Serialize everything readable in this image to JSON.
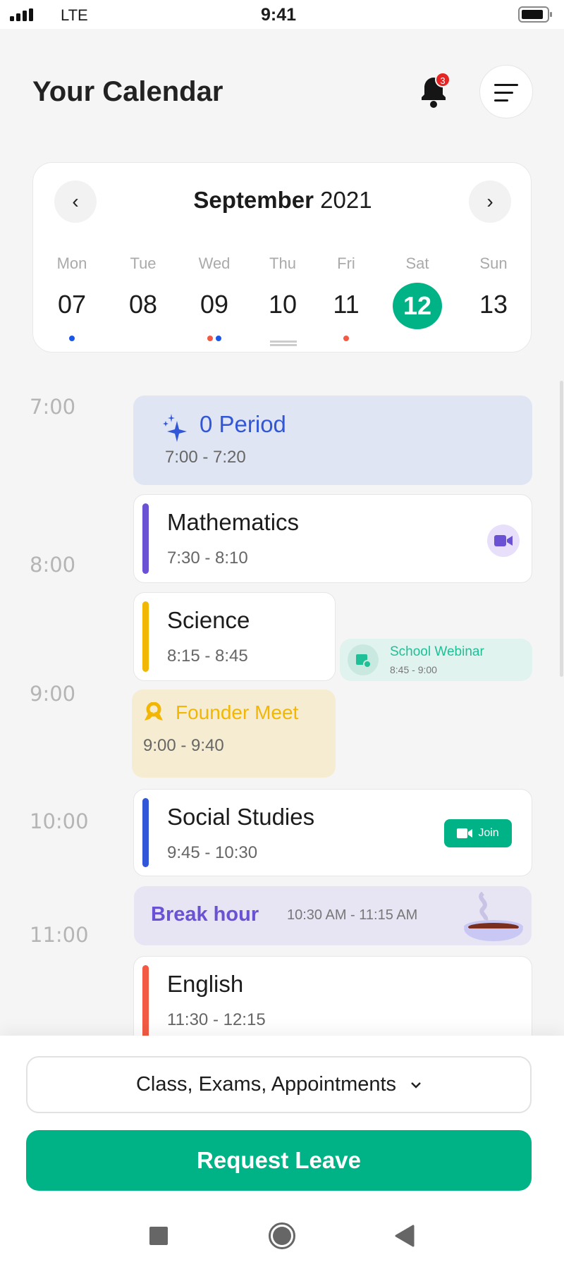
{
  "status_bar": {
    "carrier": "LTE",
    "time": "9:41"
  },
  "header": {
    "title": "Your Calendar",
    "notification_count": "3"
  },
  "calendar": {
    "month": "September",
    "year": "2021",
    "days": [
      {
        "weekday": "Mon",
        "date": "07",
        "dots": [
          "#1a56e8"
        ]
      },
      {
        "weekday": "Tue",
        "date": "08",
        "dots": []
      },
      {
        "weekday": "Wed",
        "date": "09",
        "dots": [
          "#f25a43",
          "#1a56e8"
        ]
      },
      {
        "weekday": "Thu",
        "date": "10",
        "dots": []
      },
      {
        "weekday": "Fri",
        "date": "11",
        "dots": [
          "#f25a43"
        ]
      },
      {
        "weekday": "Sat",
        "date": "12",
        "dots": [],
        "selected": true
      },
      {
        "weekday": "Sun",
        "date": "13",
        "dots": []
      }
    ]
  },
  "timeline": {
    "hours": [
      "7:00",
      "8:00",
      "9:00",
      "10:00",
      "11:00"
    ]
  },
  "events": {
    "zero_period": {
      "title": "0 Period",
      "time": "7:00 - 7:20",
      "color": "#3157d8"
    },
    "math": {
      "title": "Mathematics",
      "time": "7:30 - 8:10",
      "color": "#6b52d4"
    },
    "science": {
      "title": "Science",
      "time": "8:15 - 8:45",
      "color": "#f2b705"
    },
    "webinar": {
      "title": "School Webinar",
      "time": "8:45 - 9:00",
      "color": "#1fbf97"
    },
    "founder": {
      "title": "Founder Meet",
      "time": "9:00 - 9:40",
      "color": "#f2b705"
    },
    "social": {
      "title": "Social Studies",
      "time": "9:45 - 10:30",
      "color": "#3157d8",
      "join_label": "Join"
    },
    "break": {
      "title": "Break hour",
      "time": "10:30 AM - 11:15 AM",
      "color": "#6b52d4"
    },
    "english": {
      "title": "English",
      "time": "11:30 - 12:15",
      "color": "#f25a43"
    }
  },
  "filter": {
    "value": "Class, Exams, Appointments"
  },
  "actions": {
    "request_leave": "Request Leave"
  },
  "colors": {
    "accent": "#00b386",
    "background": "#f5f5f5"
  }
}
